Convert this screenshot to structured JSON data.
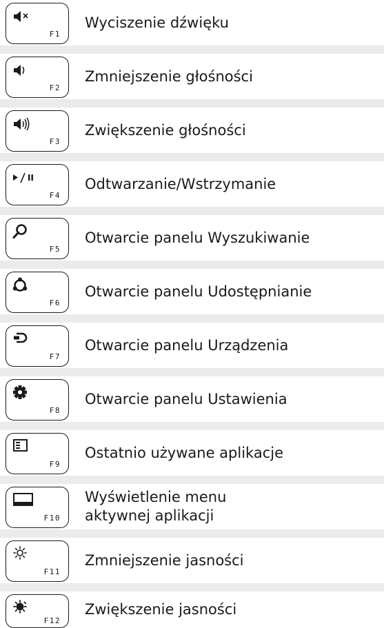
{
  "rows": [
    {
      "key": "F1",
      "icon": "mute-icon",
      "text": "Wyciszenie dźwięku"
    },
    {
      "key": "F2",
      "icon": "volume-down-icon",
      "text": "Zmniejszenie głośności"
    },
    {
      "key": "F3",
      "icon": "volume-up-icon",
      "text": "Zwiększenie głośności"
    },
    {
      "key": "F4",
      "icon": "play-pause-icon",
      "text": "Odtwarzanie/Wstrzymanie"
    },
    {
      "key": "F5",
      "icon": "search-icon",
      "text": "Otwarcie panelu Wyszukiwanie"
    },
    {
      "key": "F6",
      "icon": "share-icon",
      "text": "Otwarcie panelu Udostępnianie"
    },
    {
      "key": "F7",
      "icon": "devices-icon",
      "text": "Otwarcie panelu Urządzenia"
    },
    {
      "key": "F8",
      "icon": "gear-icon",
      "text": "Otwarcie panelu Ustawienia"
    },
    {
      "key": "F9",
      "icon": "recent-apps-icon",
      "text": "Ostatnio używane aplikacje"
    },
    {
      "key": "F10",
      "icon": "app-menu-icon",
      "text": "Wyświetlenie menu",
      "text2": "aktywnej aplikacji"
    },
    {
      "key": "F11",
      "icon": "brightness-down-icon",
      "text": "Zmniejszenie jasności"
    },
    {
      "key": "F12",
      "icon": "brightness-up-icon",
      "text": "Zwiększenie jasności"
    }
  ]
}
